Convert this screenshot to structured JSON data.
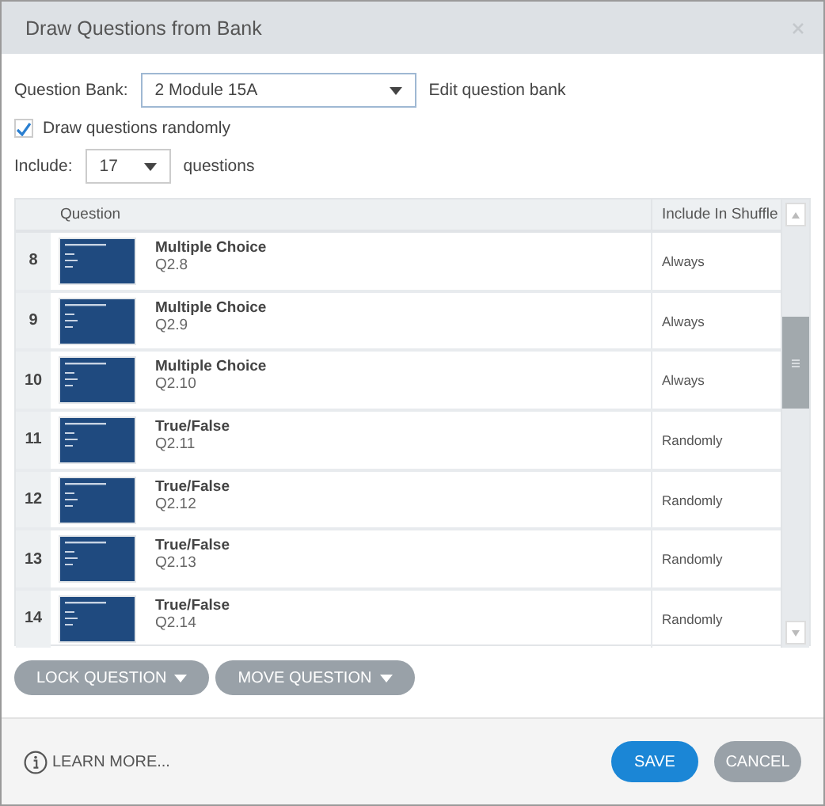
{
  "window": {
    "title": "Draw Questions from Bank"
  },
  "form": {
    "question_bank": {
      "label": "Question Bank:",
      "value": "2 Module 15A"
    },
    "edit_link": "Edit question bank",
    "draw_randomly": {
      "label": "Draw questions randomly",
      "checked": true
    },
    "include": {
      "label": "Include:",
      "value": "17",
      "suffix": "questions"
    }
  },
  "table": {
    "columns": [
      "Question",
      "Include In Shuffle"
    ],
    "rows": [
      {
        "number": "8",
        "type": "Multiple Choice",
        "id": "Q2.8",
        "shuffle": "Always"
      },
      {
        "number": "9",
        "type": "Multiple Choice",
        "id": "Q2.9",
        "shuffle": "Always"
      },
      {
        "number": "10",
        "type": "Multiple Choice",
        "id": "Q2.10",
        "shuffle": "Always"
      },
      {
        "number": "11",
        "type": "True/False",
        "id": "Q2.11",
        "shuffle": "Randomly"
      },
      {
        "number": "12",
        "type": "True/False",
        "id": "Q2.12",
        "shuffle": "Randomly"
      },
      {
        "number": "13",
        "type": "True/False",
        "id": "Q2.13",
        "shuffle": "Randomly"
      },
      {
        "number": "14",
        "type": "True/False",
        "id": "Q2.14",
        "shuffle": "Randomly"
      }
    ]
  },
  "actions": [
    "LOCK QUESTION",
    "MOVE QUESTION"
  ],
  "footer": {
    "learn_more": "LEARN MORE...",
    "buttons": [
      {
        "label": "SAVE",
        "kind": "primary"
      },
      {
        "label": "CANCEL",
        "kind": "secondary"
      }
    ]
  }
}
